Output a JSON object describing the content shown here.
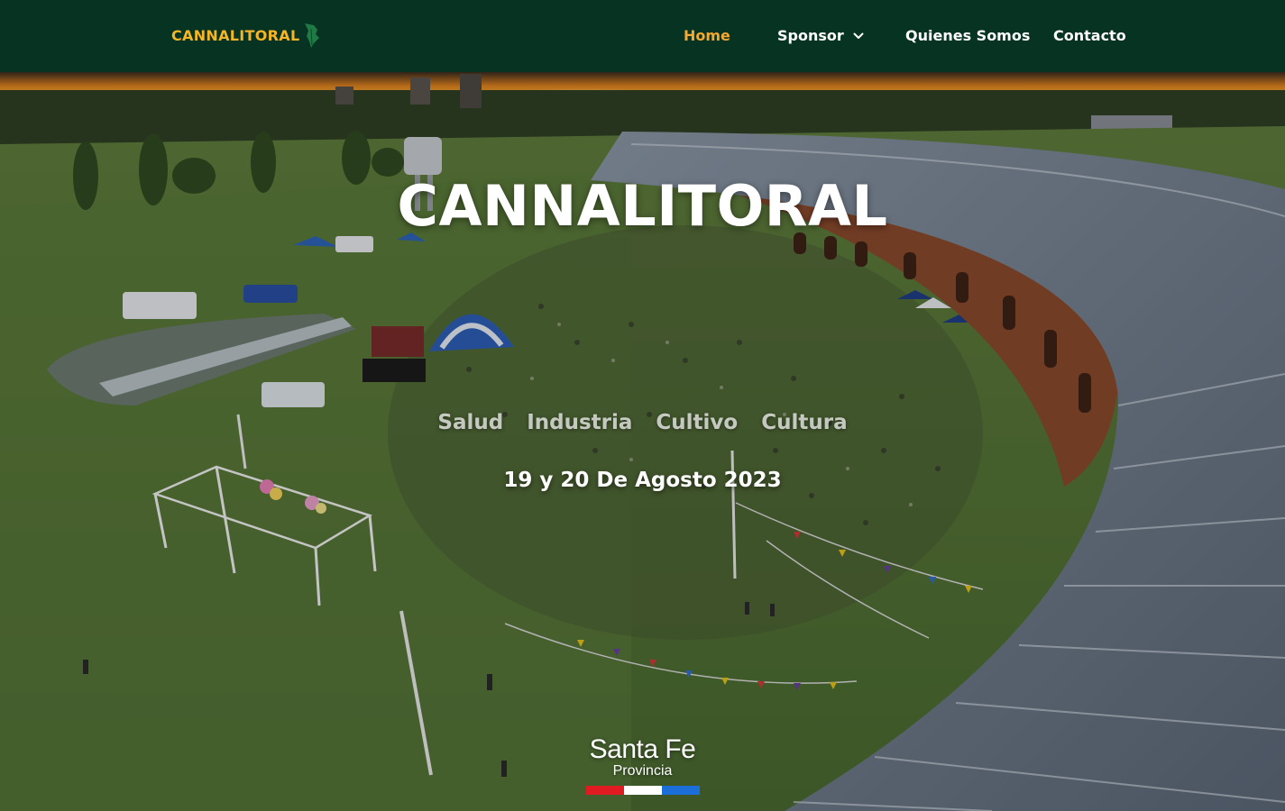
{
  "header": {
    "logo_text": "CANNALITORAL",
    "nav": {
      "home": "Home",
      "sponsor": "Sponsor",
      "quienes_somos": "Quienes Somos",
      "contacto": "Contacto"
    }
  },
  "hero": {
    "title": "CANNALITORAL",
    "tags": [
      "Salud",
      "Industria",
      "Cultivo",
      "Cultura"
    ],
    "date": "19 y 20 De Agosto 2023",
    "sponsor_logo": {
      "name": "Santa Fe",
      "sub": "Provincia"
    }
  },
  "colors": {
    "header_bg": "#063322",
    "accent": "#f3a931",
    "logo": "#f5b526",
    "flag_red": "#e11b22",
    "flag_white": "#ffffff",
    "flag_blue": "#1c6fd8"
  }
}
